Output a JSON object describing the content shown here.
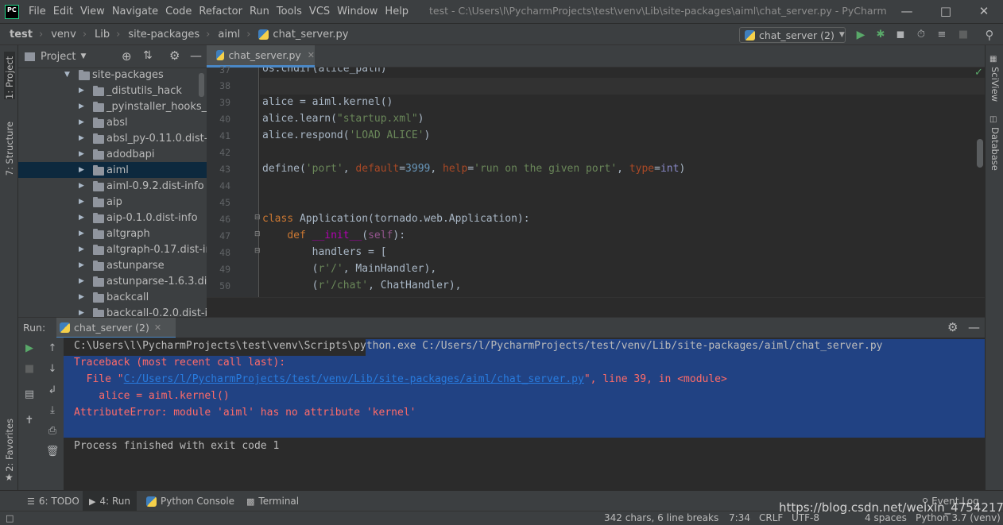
{
  "menubar": {
    "items": [
      "File",
      "Edit",
      "View",
      "Navigate",
      "Code",
      "Refactor",
      "Run",
      "Tools",
      "VCS",
      "Window",
      "Help"
    ],
    "window_title": "test - C:\\Users\\l\\PycharmProjects\\test\\venv\\Lib\\site-packages\\aiml\\chat_server.py - PyCharm"
  },
  "navbar": {
    "breadcrumbs": [
      "test",
      "venv",
      "Lib",
      "site-packages",
      "aiml",
      "chat_server.py"
    ],
    "run_config": "chat_server (2)"
  },
  "project_panel": {
    "title": "Project",
    "tree": [
      {
        "label": "site-packages",
        "expanded": true,
        "level": 0
      },
      {
        "label": "_distutils_hack",
        "level": 1
      },
      {
        "label": "_pyinstaller_hooks_con",
        "level": 1
      },
      {
        "label": "absl",
        "level": 1
      },
      {
        "label": "absl_py-0.11.0.dist-info",
        "level": 1
      },
      {
        "label": "adodbapi",
        "level": 1
      },
      {
        "label": "aiml",
        "level": 1,
        "selected": true
      },
      {
        "label": "aiml-0.9.2.dist-info",
        "level": 1
      },
      {
        "label": "aip",
        "level": 1
      },
      {
        "label": "aip-0.1.0.dist-info",
        "level": 1
      },
      {
        "label": "altgraph",
        "level": 1
      },
      {
        "label": "altgraph-0.17.dist-info",
        "level": 1
      },
      {
        "label": "astunparse",
        "level": 1
      },
      {
        "label": "astunparse-1.6.3.dist-",
        "level": 1
      },
      {
        "label": "backcall",
        "level": 1
      },
      {
        "label": "backcall-0.2.0.dist-info",
        "level": 1
      }
    ]
  },
  "left_tabs": {
    "project": "1: Project",
    "structure": "7: Structure",
    "favorites": "2: Favorites"
  },
  "right_tabs": {
    "sciview": "SciView",
    "database": "Database"
  },
  "editor": {
    "tab_label": "chat_server.py",
    "line_numbers": [
      "37",
      "38",
      "39",
      "40",
      "41",
      "42",
      "43",
      "44",
      "45",
      "46",
      "47",
      "48",
      "49",
      "50"
    ]
  },
  "run_panel": {
    "label": "Run:",
    "tab_label": "chat_server (2)",
    "console": {
      "cmd_line": "C:\\Users\\l\\PycharmProjects\\test\\venv\\Scripts\\python.exe C:/Users/l/PycharmProjects/test/venv/Lib/site-packages/aiml/chat_server.py",
      "traceback_header": "Traceback (most recent call last):",
      "file_prefix": "  File \"",
      "file_link": "C:/Users/l/PycharmProjects/test/venv/Lib/site-packages/aiml/chat_server.py",
      "file_suffix": "\", line 39, in <module>",
      "code_line": "    alice = aiml.kernel()",
      "error_line": "AttributeError: module 'aiml' has no attribute 'kernel'",
      "exit_line": "Process finished with exit code 1"
    }
  },
  "bottom_tabs": {
    "todo": "6: TODO",
    "run": "4: Run",
    "python_console": "Python Console",
    "terminal": "Terminal",
    "event_log": "Event Log"
  },
  "status_bar": {
    "chars": "342 chars, 6 line breaks",
    "position": "7:34",
    "line_sep": "CRLF",
    "encoding": "UTF-8",
    "indent": "4 spaces",
    "interpreter": "Python 3.7 (venv)"
  },
  "watermark": "https://blog.csdn.net/weixin_47542175",
  "colors": {
    "selection": "#214283",
    "error": "#ff6b68",
    "link": "#287bde",
    "keyword": "#cc7832",
    "string": "#6a8759",
    "number": "#6897bb"
  }
}
